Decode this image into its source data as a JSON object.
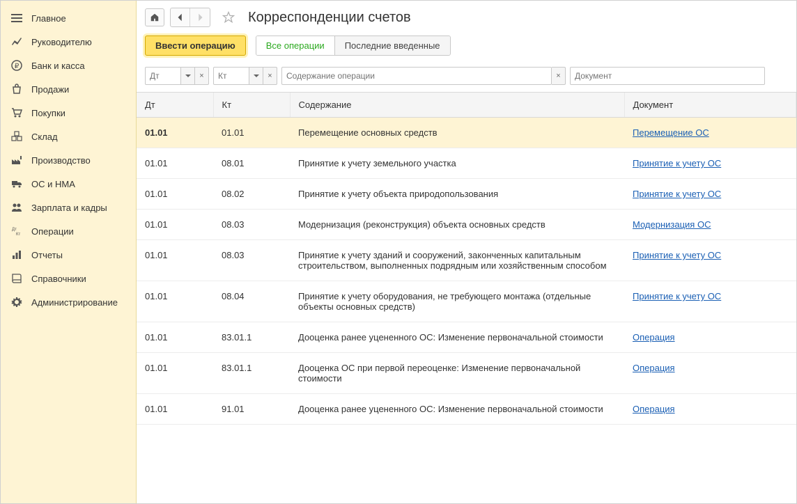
{
  "sidebar": {
    "items": [
      {
        "label": "Главное",
        "icon": "menu"
      },
      {
        "label": "Руководителю",
        "icon": "chart"
      },
      {
        "label": "Банк и касса",
        "icon": "ruble"
      },
      {
        "label": "Продажи",
        "icon": "bag"
      },
      {
        "label": "Покупки",
        "icon": "cart"
      },
      {
        "label": "Склад",
        "icon": "boxes"
      },
      {
        "label": "Производство",
        "icon": "factory"
      },
      {
        "label": "ОС и НМА",
        "icon": "truck"
      },
      {
        "label": "Зарплата и кадры",
        "icon": "people"
      },
      {
        "label": "Операции",
        "icon": "dtkt"
      },
      {
        "label": "Отчеты",
        "icon": "report"
      },
      {
        "label": "Справочники",
        "icon": "book"
      },
      {
        "label": "Администрирование",
        "icon": "gear"
      }
    ]
  },
  "header": {
    "title": "Корреспонденции счетов"
  },
  "toolbar": {
    "primary": "Ввести операцию",
    "seg_all": "Все операции",
    "seg_recent": "Последние введенные"
  },
  "filters": {
    "dt_ph": "Дт",
    "kt_ph": "Кт",
    "content_ph": "Содержание операции",
    "doc_ph": "Документ"
  },
  "table": {
    "headers": {
      "dt": "Дт",
      "kt": "Кт",
      "content": "Содержание",
      "doc": "Документ"
    },
    "rows": [
      {
        "dt": "01.01",
        "kt": "01.01",
        "content": "Перемещение основных средств",
        "doc": "Перемещение ОС",
        "selected": true
      },
      {
        "dt": "01.01",
        "kt": "08.01",
        "content": "Принятие к учету земельного участка",
        "doc": "Принятие к учету ОС"
      },
      {
        "dt": "01.01",
        "kt": "08.02",
        "content": "Принятие к учету объекта природопользования",
        "doc": "Принятие к учету ОС"
      },
      {
        "dt": "01.01",
        "kt": "08.03",
        "content": "Модернизация (реконструкция) объекта основных средств",
        "doc": "Модернизация ОС"
      },
      {
        "dt": "01.01",
        "kt": "08.03",
        "content": "Принятие к учету зданий и сооружений, законченных капитальным строительством, выполненных подрядным или хозяйственным способом",
        "doc": "Принятие к учету ОС"
      },
      {
        "dt": "01.01",
        "kt": "08.04",
        "content": "Принятие к учету оборудования, не требующего монтажа (отдельные объекты основных средств)",
        "doc": "Принятие к учету ОС"
      },
      {
        "dt": "01.01",
        "kt": "83.01.1",
        "content": "Дооценка ранее уцененного ОС: Изменение первоначальной стоимости",
        "doc": "Операция"
      },
      {
        "dt": "01.01",
        "kt": "83.01.1",
        "content": "Дооценка ОС при первой переоценке: Изменение первоначальной стоимости",
        "doc": "Операция"
      },
      {
        "dt": "01.01",
        "kt": "91.01",
        "content": "Дооценка ранее уцененного ОС: Изменение первоначальной стоимости",
        "doc": "Операция"
      }
    ]
  }
}
